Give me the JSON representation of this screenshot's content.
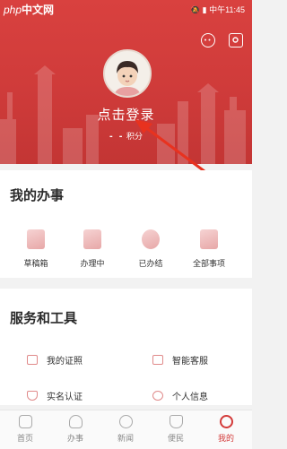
{
  "status_bar": {
    "logo_prefix": "php",
    "logo_text": "中文网",
    "time": "中午11:45"
  },
  "profile": {
    "login_label": "点击登录",
    "points_value": "- -",
    "points_label": "积分"
  },
  "my_affairs": {
    "title": "我的办事",
    "items": [
      {
        "label": "草稿箱",
        "icon": "draft-icon"
      },
      {
        "label": "办理中",
        "icon": "in-progress-icon"
      },
      {
        "label": "已办结",
        "icon": "completed-icon"
      },
      {
        "label": "全部事项",
        "icon": "all-items-icon"
      }
    ]
  },
  "services": {
    "title": "服务和工具",
    "items": [
      {
        "label": "我的证照",
        "icon": "license-icon"
      },
      {
        "label": "智能客服",
        "icon": "chat-service-icon"
      },
      {
        "label": "实名认证",
        "icon": "verify-icon"
      },
      {
        "label": "个人信息",
        "icon": "person-icon"
      }
    ]
  },
  "tabbar": {
    "items": [
      {
        "label": "首页",
        "icon": "home-icon"
      },
      {
        "label": "办事",
        "icon": "heart-icon"
      },
      {
        "label": "新闻",
        "icon": "news-icon"
      },
      {
        "label": "便民",
        "icon": "shield-icon"
      },
      {
        "label": "我的",
        "icon": "profile-icon"
      }
    ],
    "active_index": 4
  },
  "colors": {
    "accent": "#d33a39",
    "header": "#d9413f",
    "arrow": "#e8321f"
  }
}
